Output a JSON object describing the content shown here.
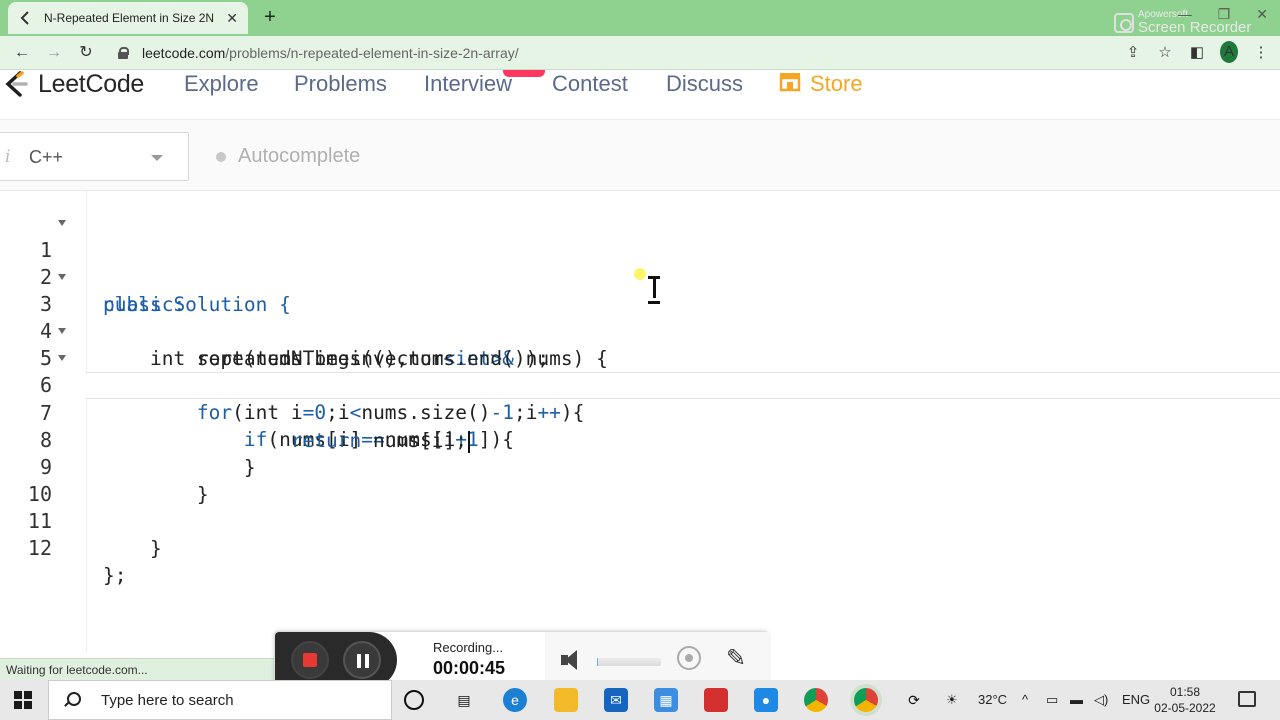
{
  "browser": {
    "tab_title": "N-Repeated Element in Size 2N A",
    "tab_close": "✕",
    "new_tab": "+",
    "url_host": "leetcode.com",
    "url_path": "/problems/n-repeated-element-in-size-2n-array/",
    "avatar_letter": "A",
    "status_text": "Waiting for leetcode.com..."
  },
  "watermark": {
    "line1": "Apowersoft",
    "line2": "Screen Recorder"
  },
  "leetcode_nav": {
    "logo": "LeetCode",
    "links": [
      "Explore",
      "Problems",
      "Interview",
      "Contest",
      "Discuss",
      "Store"
    ]
  },
  "editor_toolbar": {
    "info_icon": "i",
    "language": "C++",
    "autocomplete": "Autocomplete"
  },
  "code": {
    "active_line": 7,
    "lines": [
      {
        "n": "1",
        "fold": true
      },
      {
        "n": "2",
        "fold": false
      },
      {
        "n": "3",
        "fold": true
      },
      {
        "n": "4",
        "fold": false
      },
      {
        "n": "5",
        "fold": true
      },
      {
        "n": "6",
        "fold": true
      },
      {
        "n": "7",
        "fold": false
      },
      {
        "n": "8",
        "fold": false
      },
      {
        "n": "9",
        "fold": false
      },
      {
        "n": "10",
        "fold": false
      },
      {
        "n": "11",
        "fold": false
      },
      {
        "n": "12",
        "fold": false
      }
    ],
    "text": {
      "l1_kw": "class",
      "l1_rest": " Solution {",
      "l2_kw": "public:",
      "l3_a": "    int repeatedNTimes(vector",
      "l3_b": "<int>&",
      "l3_c": " nums) {",
      "l4": "        sort(nums.begin(),nums.end());",
      "l5_kw": "        for",
      "l5_a": "(int i",
      "l5_b": "=",
      "l5_c": "0",
      "l5_d": ";i",
      "l5_e": "<",
      "l5_f": "nums.size()",
      "l5_g": "-1",
      "l5_h": ";i",
      "l5_i": "++",
      "l5_j": "){",
      "l6_kw": "            if",
      "l6_a": "(nums[i]",
      "l6_b": "==",
      "l6_c": "nums[i",
      "l6_d": "+1",
      "l6_e": "]){",
      "l7_kw": "                return",
      "l7_rest": " nums[i];",
      "l8": "            }",
      "l9": "        }",
      "l10": "",
      "l11": "    }",
      "l12": "};"
    }
  },
  "recorder": {
    "status": "Recording...",
    "time": "00:00:45",
    "volume_level": 0.02
  },
  "taskbar": {
    "search_placeholder": "Type here to search",
    "temperature": "32°C",
    "language": "ENG",
    "time": "01:58",
    "date": "02-05-2022"
  },
  "colors": {
    "tabstrip": "#8fd28f",
    "keyword": "#1d5fa8",
    "store": "#f5a623",
    "nav_link": "#5a6a8a",
    "record_stop": "#e53935"
  }
}
